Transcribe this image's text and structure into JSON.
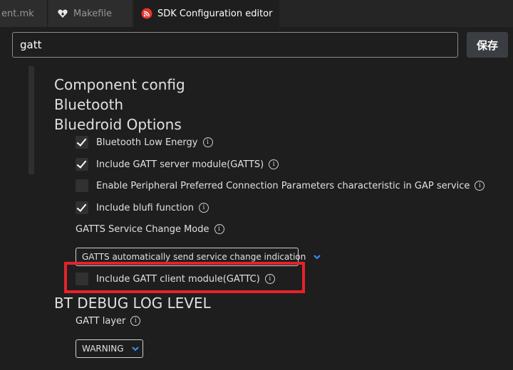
{
  "tabs": [
    {
      "label": "ent.mk"
    },
    {
      "label": "Makefile",
      "icon": "heart-icon"
    },
    {
      "label": "SDK Configuration editor",
      "icon": "sdk-logo-icon",
      "close": "✕",
      "active": true
    }
  ],
  "search": {
    "value": "gatt"
  },
  "toolbar": {
    "save_label": "保存"
  },
  "headings": {
    "component_config": "Component config",
    "bluetooth": "Bluetooth",
    "bluedroid": "Bluedroid Options",
    "bt_debug": "BT DEBUG LOG LEVEL"
  },
  "options": [
    {
      "label": "Bluetooth Low Energy",
      "checked": true
    },
    {
      "label": "Include GATT server module(GATTS)",
      "checked": true
    },
    {
      "label": "Enable Peripheral Preferred Connection Parameters characteristic in GAP service",
      "checked": false
    },
    {
      "label": "Include blufi function",
      "checked": true
    }
  ],
  "gatts_service_change": {
    "label": "GATTS Service Change Mode",
    "selected": "GATTS automatically send service change indication"
  },
  "gattc": {
    "label": "Include GATT client module(GATTC)",
    "checked": false
  },
  "gatt_layer": {
    "label": "GATT layer",
    "selected": "WARNING"
  },
  "colors": {
    "accent": "#3794ff",
    "highlight": "#e6222c",
    "background": "#1e1e1e"
  }
}
